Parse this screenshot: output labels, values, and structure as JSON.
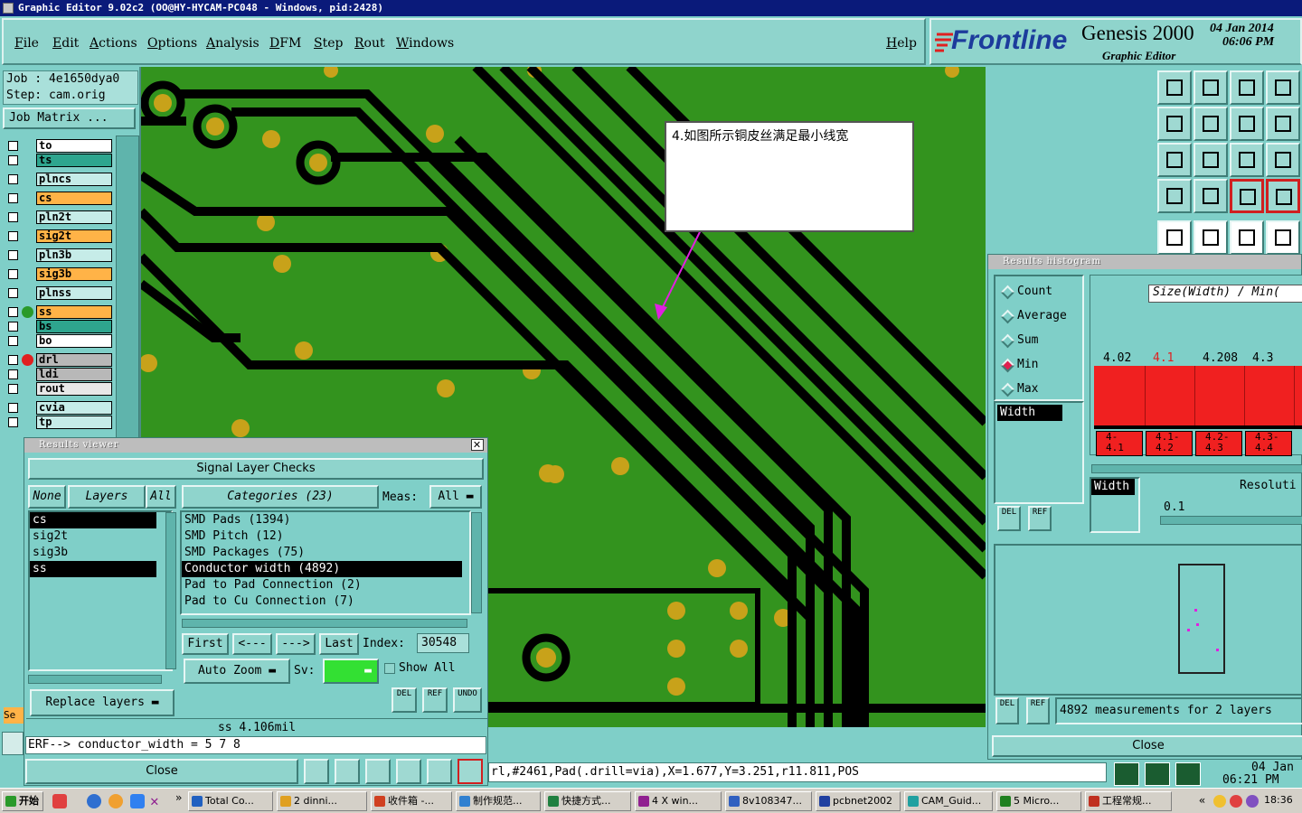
{
  "window": {
    "title": "Graphic Editor 9.02c2  (OO@HY-HYCAM-PC048 - Windows, pid:2428)"
  },
  "menu": [
    "File",
    "Edit",
    "Actions",
    "Options",
    "Analysis",
    "DFM",
    "Step",
    "Rout",
    "Windows"
  ],
  "help_label": "Help",
  "brand": {
    "logo": "Frontline",
    "product": "Genesis 2000",
    "subtitle": "Graphic Editor",
    "date": "04 Jan 2014",
    "time": "06:06 PM"
  },
  "job": {
    "job_line": "Job : 4e1650dya0",
    "step_line": "Step: cam.orig",
    "matrix_button": "Job Matrix ..."
  },
  "layers": [
    {
      "name": "to",
      "color": "#ffffff"
    },
    {
      "name": "ts",
      "color": "#2ea58e"
    },
    {
      "name": "plncs",
      "color": "#c6ece8"
    },
    {
      "name": "cs",
      "color": "#ffb347"
    },
    {
      "name": "pln2t",
      "color": "#c6ece8"
    },
    {
      "name": "sig2t",
      "color": "#ffb347"
    },
    {
      "name": "pln3b",
      "color": "#c6ece8"
    },
    {
      "name": "sig3b",
      "color": "#ffb347"
    },
    {
      "name": "plnss",
      "color": "#c6ece8"
    },
    {
      "name": "ss",
      "color": "#ffb347"
    },
    {
      "name": "bs",
      "color": "#2ea58e"
    },
    {
      "name": "bo",
      "color": "#ffffff"
    },
    {
      "name": "drl",
      "color": "#b8b8b8"
    },
    {
      "name": "ldi",
      "color": "#b8b8b8"
    },
    {
      "name": "rout",
      "color": "#e8e8e8"
    },
    {
      "name": "cvia",
      "color": "#c6ece8"
    },
    {
      "name": "tp",
      "color": "#c6ece8"
    }
  ],
  "annotation": {
    "text": "4.如图所示铜皮丝满足最小线宽"
  },
  "results_viewer": {
    "title": "Results viewer",
    "header": "Signal Layer Checks",
    "none_btn": "None",
    "layers_btn": "Layers",
    "all_btn": "All",
    "categories_btn": "Categories (23)",
    "meas_label": "Meas:",
    "meas_value": "All",
    "layers": [
      {
        "name": "cs",
        "sel": true
      },
      {
        "name": "sig2t",
        "sel": false
      },
      {
        "name": "sig3b",
        "sel": false
      },
      {
        "name": "ss",
        "sel": true
      }
    ],
    "categories": [
      {
        "name": "SMD Pads (1394)",
        "sel": false
      },
      {
        "name": "SMD Pitch (12)",
        "sel": false
      },
      {
        "name": "SMD Packages (75)",
        "sel": false
      },
      {
        "name": "Conductor width (4892)",
        "sel": true
      },
      {
        "name": "Pad to Pad Connection (2)",
        "sel": false
      },
      {
        "name": "Pad to Cu Connection (7)",
        "sel": false
      }
    ],
    "first_btn": "First",
    "prev_btn": "<---",
    "next_btn": "--->",
    "last_btn": "Last",
    "index_label": "Index:",
    "index_value": "30548",
    "auto_zoom": "Auto Zoom",
    "sv_label": "Sv:",
    "show_all": "Show All",
    "replace_layers": "Replace layers",
    "del": "DEL",
    "ref": "REF",
    "undo": "UNDO",
    "status": "ss 4.106mil",
    "erf": "ERF--> conductor_width = 5 7 8",
    "close": "Close"
  },
  "histogram": {
    "title": "Results histogram",
    "options": [
      {
        "label": "Count",
        "on": false
      },
      {
        "label": "Average",
        "on": false
      },
      {
        "label": "Sum",
        "on": false
      },
      {
        "label": "Min",
        "on": true
      },
      {
        "label": "Max",
        "on": false
      }
    ],
    "width_label": "Width",
    "size_header": "Size(Width) / Min(",
    "bars": [
      {
        "value": "4.02",
        "range": "4-\n4.1",
        "hi": false
      },
      {
        "value": "4.1",
        "range": "4.1-\n4.2",
        "hi": true
      },
      {
        "value": "4.208",
        "range": "4.2-\n4.3",
        "hi": false
      },
      {
        "value": "4.3",
        "range": "4.3-\n4.4",
        "hi": false
      }
    ],
    "resolution_label": "Resoluti",
    "resolution_value": "0.1",
    "width_bottom": "Width",
    "measurements": "4892 measurements for 2 layers",
    "close": "Close",
    "del": "DEL",
    "ref": "REF"
  },
  "statusbar": {
    "text": "rl,#2461,Pad(.drill=via),X=1.677,Y=3.251,r11.811,POS",
    "date": "04 Jan",
    "time": "06:21 PM"
  },
  "se_label": "Se",
  "taskbar": {
    "start": "开始",
    "items": [
      "Total Co...",
      "2 dinni...",
      "收件箱 -...",
      "制作规范...",
      "快捷方式...",
      "4 X win...",
      "8v108347...",
      "pcbnet2002",
      "CAM_Guid...",
      "5 Micro...",
      "工程常规..."
    ],
    "clock": "18:36"
  }
}
